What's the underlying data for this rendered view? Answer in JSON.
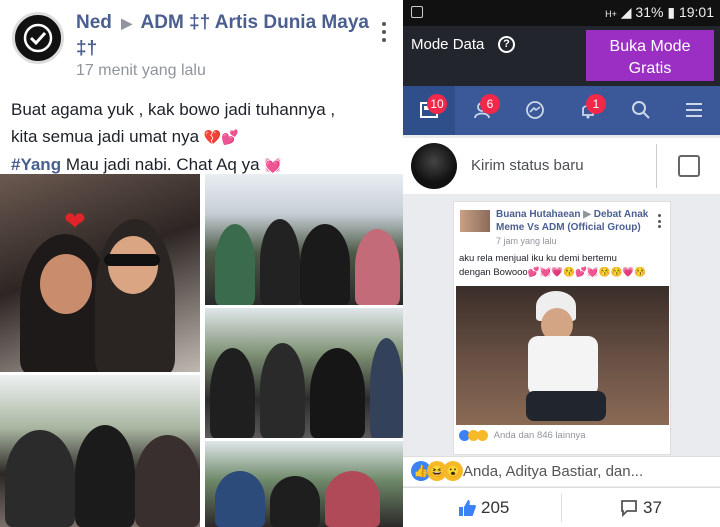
{
  "left_post": {
    "author": "Ned",
    "group": "ADM ‡† Artis Dunia Maya ‡†",
    "time": "17 menit yang lalu",
    "line1": "Buat agama yuk , kak bowo jadi tuhannya ,",
    "line2": "kita semua jadi umat nya",
    "line2_emoji": "💔💕",
    "line3_hashtag": "#Yang",
    "line3_rest": " Mau jadi nabi.  Chat Aq ya",
    "line3_emoji": "💓",
    "photo_heart": "❤",
    "avatar_icon": "check-icon"
  },
  "status_bar": {
    "signal": "H+",
    "battery": "31%",
    "time": "19:01"
  },
  "data_mode": {
    "label": "Mode Data",
    "help": "?",
    "button_line1": "Buka Mode",
    "button_line2": "Gratis"
  },
  "nav": {
    "items": [
      {
        "icon": "news-feed-icon",
        "badge": "10"
      },
      {
        "icon": "friends-icon",
        "badge": "6"
      },
      {
        "icon": "messenger-icon",
        "badge": ""
      },
      {
        "icon": "notifications-icon",
        "badge": "1"
      },
      {
        "icon": "search-icon",
        "badge": ""
      },
      {
        "icon": "menu-icon",
        "badge": ""
      }
    ],
    "colors": {
      "bar": "#3b5998",
      "badge": "#f02849"
    }
  },
  "composer": {
    "placeholder": "Kirim status baru"
  },
  "shared_post": {
    "author": "Buana Hutahaean",
    "group": "Debat Anak Meme Vs ADM (Official Group)",
    "time": "7 jam yang lalu",
    "text_line1": "aku rela menjual iku ku demi bertemu",
    "text_line2": "dengan Bowooo",
    "text_emoji": "💕💓💗😚💕💓😚😚💗😚",
    "reactions": "Anda dan 846 lainnya"
  },
  "reactions_row": {
    "text": "Anda, Aditya Bastiar, dan..."
  },
  "counts": {
    "likes": "205",
    "comments": "37"
  }
}
